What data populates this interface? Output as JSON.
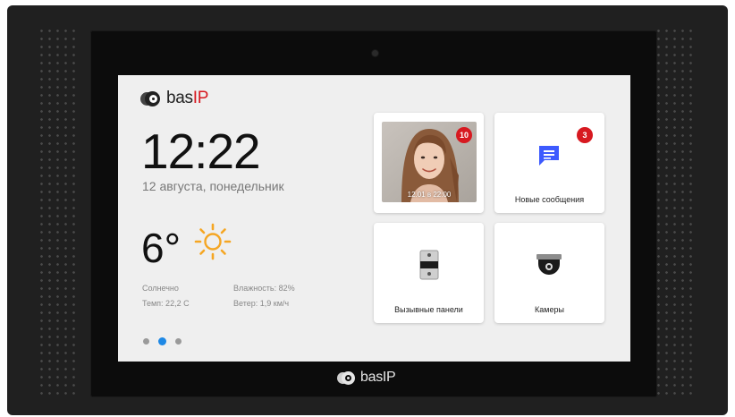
{
  "brand": {
    "name": "bas",
    "suffix": "IP",
    "accent_color": "#d71920",
    "icon": "bas-ip-logo-icon"
  },
  "clock": {
    "time": "12:22",
    "date": "12 августа, понедельник"
  },
  "weather": {
    "temperature": "6°",
    "icon": "sun-icon",
    "condition": "Солнечно",
    "temp_detail": "Темп: 22,2 С",
    "humidity": "Влажность: 82%",
    "wind": "Ветер: 1,9 км/ч",
    "sun_color": "#f5a623"
  },
  "pager": {
    "count": 3,
    "active_index": 1,
    "active_color": "#1e88e5"
  },
  "tiles": [
    {
      "id": "visitor",
      "label": "",
      "badge": "10",
      "photo_caption": "12.01 в 22:00",
      "icon": "visitor-photo"
    },
    {
      "id": "messages",
      "label": "Новые сообщения",
      "badge": "3",
      "icon": "message-icon",
      "icon_color": "#3d5afe"
    },
    {
      "id": "panels",
      "label": "Вызывные панели",
      "icon": "intercom-panel-icon"
    },
    {
      "id": "cameras",
      "label": "Камеры",
      "icon": "dome-camera-icon"
    }
  ],
  "bezel_brand": {
    "name": "bas",
    "suffix": "IP"
  }
}
